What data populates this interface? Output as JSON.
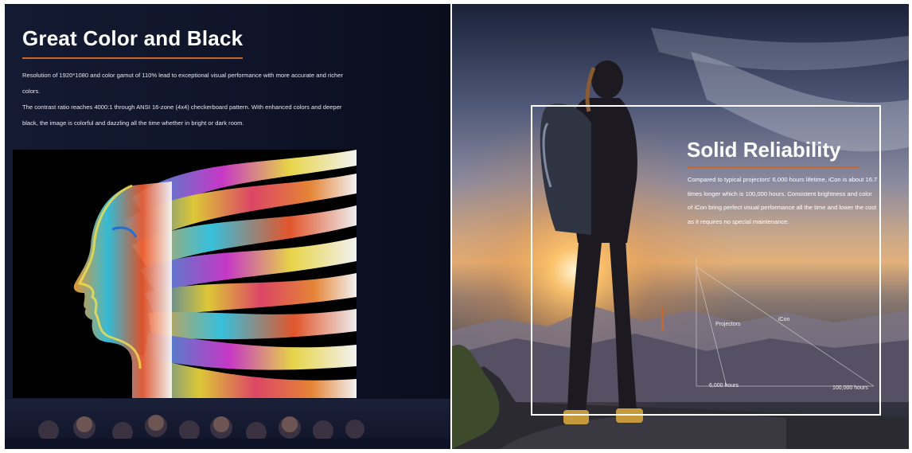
{
  "left": {
    "title": "Great Color and Black",
    "paragraph1": "Resolution of 1920*1080 and color gamut of 110% lead to exceptional visual performance with more accurate and richer colors.",
    "paragraph2": "The contrast ratio reaches 4000:1 through ANSI 16-zone (4x4) checkerboard pattern. With enhanced colors and deeper black, the image is colorful and dazzling all the time whether in bright or dark room."
  },
  "right": {
    "title": "Solid Reliability",
    "paragraph": "Compared to typical projectors' 6,000 hours lifetime, iCon is about 16.7 times longer which is 100,000 hours. Consistent brightness and color of iCon bring perfect visual performance all the time and lower the cost as it requires no special maintenance.",
    "chart": {
      "series_labels": [
        "Projectors",
        "iCon"
      ],
      "x_labels": [
        "6,000 hours",
        "100,000 hours"
      ]
    }
  },
  "colors": {
    "accent": "#c8662c",
    "left_background": "#111730",
    "text": "#ffffff"
  }
}
